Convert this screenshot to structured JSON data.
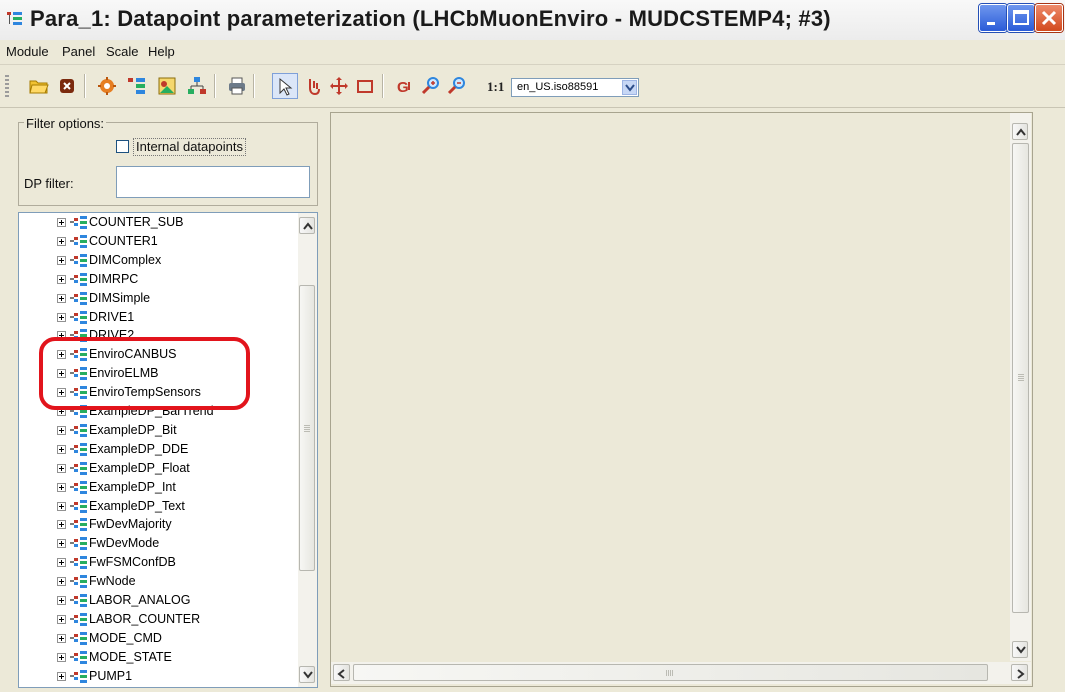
{
  "window": {
    "title": "Para_1: Datapoint parameterization (LHCbMuonEnviro - MUDCSTEMP4; #3)"
  },
  "menubar": {
    "items": [
      "Module",
      "Panel",
      "Scale",
      "Help"
    ]
  },
  "toolbar": {
    "buttons": [
      "open-folder-icon",
      "close-module-icon",
      "settings-icon",
      "datapoint-tree-icon",
      "image-icon",
      "hierarchy-icon",
      "print-icon",
      "select-arrow-icon",
      "cursor-hand-icon",
      "move-cross-icon",
      "rectangle-icon",
      "zoom-text-icon",
      "zoom-in-icon",
      "zoom-out-icon"
    ],
    "one_to_one_label": "1:1",
    "locale_value": "en_US.iso88591"
  },
  "filter": {
    "legend": "Filter options:",
    "internal_datapoints_label": "Internal datapoints",
    "internal_datapoints_checked": false,
    "dp_filter_label": "DP filter:",
    "dp_filter_value": ""
  },
  "tree": {
    "items": [
      "COUNTER_SUB",
      "COUNTER1",
      "DIMComplex",
      "DIMRPC",
      "DIMSimple",
      "DRIVE1",
      "DRIVE2",
      "EnviroCANBUS",
      "EnviroELMB",
      "EnviroTempSensors",
      "ExampleDP_BarTrend",
      "ExampleDP_Bit",
      "ExampleDP_DDE",
      "ExampleDP_Float",
      "ExampleDP_Int",
      "ExampleDP_Text",
      "FwDevMajority",
      "FwDevMode",
      "FwFSMConfDB",
      "FwNode",
      "LABOR_ANALOG",
      "LABOR_COUNTER",
      "MODE_CMD",
      "MODE_STATE",
      "PUMP1"
    ]
  },
  "colors": {
    "highlight": "#e2141c",
    "window_bg": "#ece9d8"
  }
}
